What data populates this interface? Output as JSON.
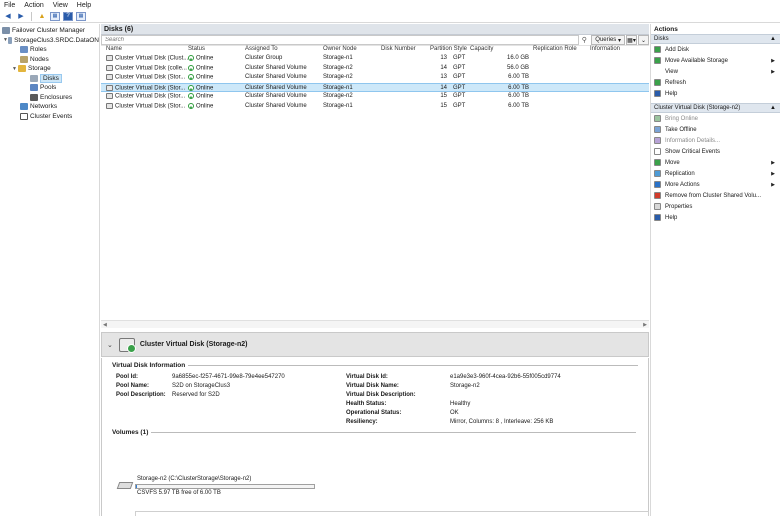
{
  "menu": [
    "File",
    "Action",
    "View",
    "Help"
  ],
  "tree": {
    "root": "Failover Cluster Manager",
    "cluster": "StorageClus3.SRDC.DataON",
    "items": [
      "Roles",
      "Nodes",
      "Storage",
      "Disks",
      "Pools",
      "Enclosures",
      "Networks",
      "Cluster Events"
    ]
  },
  "center": {
    "title": "Disks (6)",
    "search_placeholder": "Search",
    "queries_label": "Queries",
    "columns": [
      "Name",
      "Status",
      "Assigned To",
      "Owner Node",
      "Disk Number",
      "Partition Style",
      "Capacity",
      "Replication Role",
      "Information"
    ],
    "rows": [
      {
        "name": "Cluster Virtual Disk (Clust...",
        "status": "Online",
        "assigned": "Cluster Group",
        "owner": "Storage-n1",
        "disk_number": "13",
        "partition": "GPT",
        "capacity": "16.0 GB"
      },
      {
        "name": "Cluster Virtual Disk (colle...",
        "status": "Online",
        "assigned": "Cluster Shared Volume",
        "owner": "Storage-n2",
        "disk_number": "14",
        "partition": "GPT",
        "capacity": "56.0 GB"
      },
      {
        "name": "Cluster Virtual Disk (Stor...",
        "status": "Online",
        "assigned": "Cluster Shared Volume",
        "owner": "Storage-n2",
        "disk_number": "13",
        "partition": "GPT",
        "capacity": "6.00 TB"
      },
      {
        "name": "Cluster Virtual Disk (Stor...",
        "status": "Online",
        "assigned": "Cluster Shared Volume",
        "owner": "Storage-n1",
        "disk_number": "14",
        "partition": "GPT",
        "capacity": "6.00 TB"
      },
      {
        "name": "Cluster Virtual Disk (Stor...",
        "status": "Online",
        "assigned": "Cluster Shared Volume",
        "owner": "Storage-n2",
        "disk_number": "15",
        "partition": "GPT",
        "capacity": "6.00 TB"
      },
      {
        "name": "Cluster Virtual Disk (Stor...",
        "status": "Online",
        "assigned": "Cluster Shared Volume",
        "owner": "Storage-n1",
        "disk_number": "15",
        "partition": "GPT",
        "capacity": "6.00 TB"
      }
    ],
    "selected_row": 3
  },
  "detail": {
    "title": "Cluster Virtual Disk (Storage-n2)",
    "section_info": "Virtual Disk Information",
    "pool_id_label": "Pool Id:",
    "pool_id": "9a6855ec-f257-4671-99e8-79e4ee547270",
    "pool_name_label": "Pool Name:",
    "pool_name": "S2D on StorageClus3",
    "pool_desc_label": "Pool Description:",
    "pool_desc": "Reserved for S2D",
    "vd_id_label": "Virtual Disk Id:",
    "vd_id": "e1a9e3e3-960f-4cea-92b6-55f005cd9774",
    "vd_name_label": "Virtual Disk Name:",
    "vd_name": "Storage-n2",
    "vd_desc_label": "Virtual Disk Description:",
    "vd_desc": "",
    "health_label": "Health Status:",
    "health": "Healthy",
    "op_label": "Operational Status:",
    "op": "OK",
    "resiliency_label": "Resiliency:",
    "resiliency": "Mirror, Columns: 8 , Interleave: 256 KB",
    "volumes_title": "Volumes (1)",
    "volume_name": "Storage-n2 (C:\\ClusterStorage\\Storage-n2)",
    "volume_fs": "CSVFS 5.97 TB free of 6.00 TB",
    "volume_used_fraction": 0.005
  },
  "actions": {
    "title": "Actions",
    "section1": "Disks",
    "items1": [
      {
        "label": "Add Disk",
        "icon": "add-disk-icon",
        "sub": false
      },
      {
        "label": "Move Available Storage",
        "icon": "move-storage-icon",
        "sub": true
      },
      {
        "label": "View",
        "icon": "",
        "sub": true
      },
      {
        "label": "Refresh",
        "icon": "refresh-icon",
        "sub": false
      },
      {
        "label": "Help",
        "icon": "help-icon",
        "sub": false
      }
    ],
    "section2": "Cluster Virtual Disk (Storage-n2)",
    "items2": [
      {
        "label": "Bring Online",
        "icon": "bring-online-icon",
        "sub": false,
        "disabled": true
      },
      {
        "label": "Take Offline",
        "icon": "take-offline-icon",
        "sub": false,
        "disabled": false
      },
      {
        "label": "Information Details...",
        "icon": "information-details-icon",
        "sub": false,
        "disabled": true
      },
      {
        "label": "Show Critical Events",
        "icon": "critical-events-icon",
        "sub": false,
        "disabled": false
      },
      {
        "label": "Move",
        "icon": "move-icon",
        "sub": true,
        "disabled": false
      },
      {
        "label": "Replication",
        "icon": "replication-icon",
        "sub": true,
        "disabled": false
      },
      {
        "label": "More Actions",
        "icon": "more-actions-icon",
        "sub": true,
        "disabled": false
      },
      {
        "label": "Remove from Cluster Shared Volu...",
        "icon": "remove-csv-icon",
        "sub": false,
        "disabled": false
      },
      {
        "label": "Properties",
        "icon": "properties-icon",
        "sub": false,
        "disabled": false
      },
      {
        "label": "Help",
        "icon": "help-icon",
        "sub": false,
        "disabled": false
      }
    ]
  }
}
